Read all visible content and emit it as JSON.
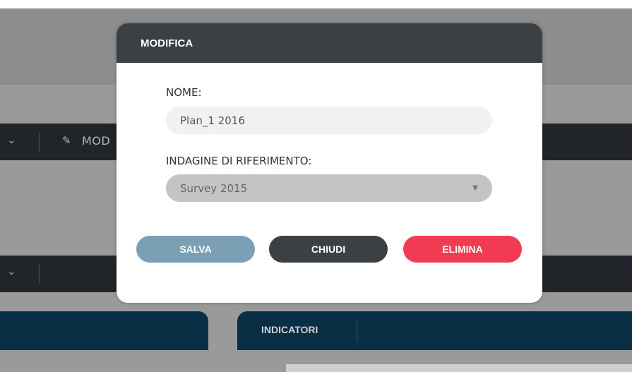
{
  "background": {
    "toolbar_partial_label": "MOD",
    "tab_label": "INDICATORI"
  },
  "modal": {
    "title": "MODIFICA",
    "name_label": "NOME:",
    "name_value": "Plan_1 2016",
    "reference_label": "INDAGINE DI RIFERIMENTO:",
    "reference_selected": "Survey 2015",
    "buttons": {
      "save": "SALVA",
      "close": "CHIUDI",
      "delete": "ELIMINA"
    }
  },
  "colors": {
    "header": "#3b4045",
    "save_button": "#7b9fb5",
    "close_button": "#3b4045",
    "delete_button": "#f13b52",
    "tab_bar": "#0a2e44"
  },
  "icons": [
    "chevron-down-icon",
    "pencil-icon",
    "select-arrow-icon"
  ]
}
